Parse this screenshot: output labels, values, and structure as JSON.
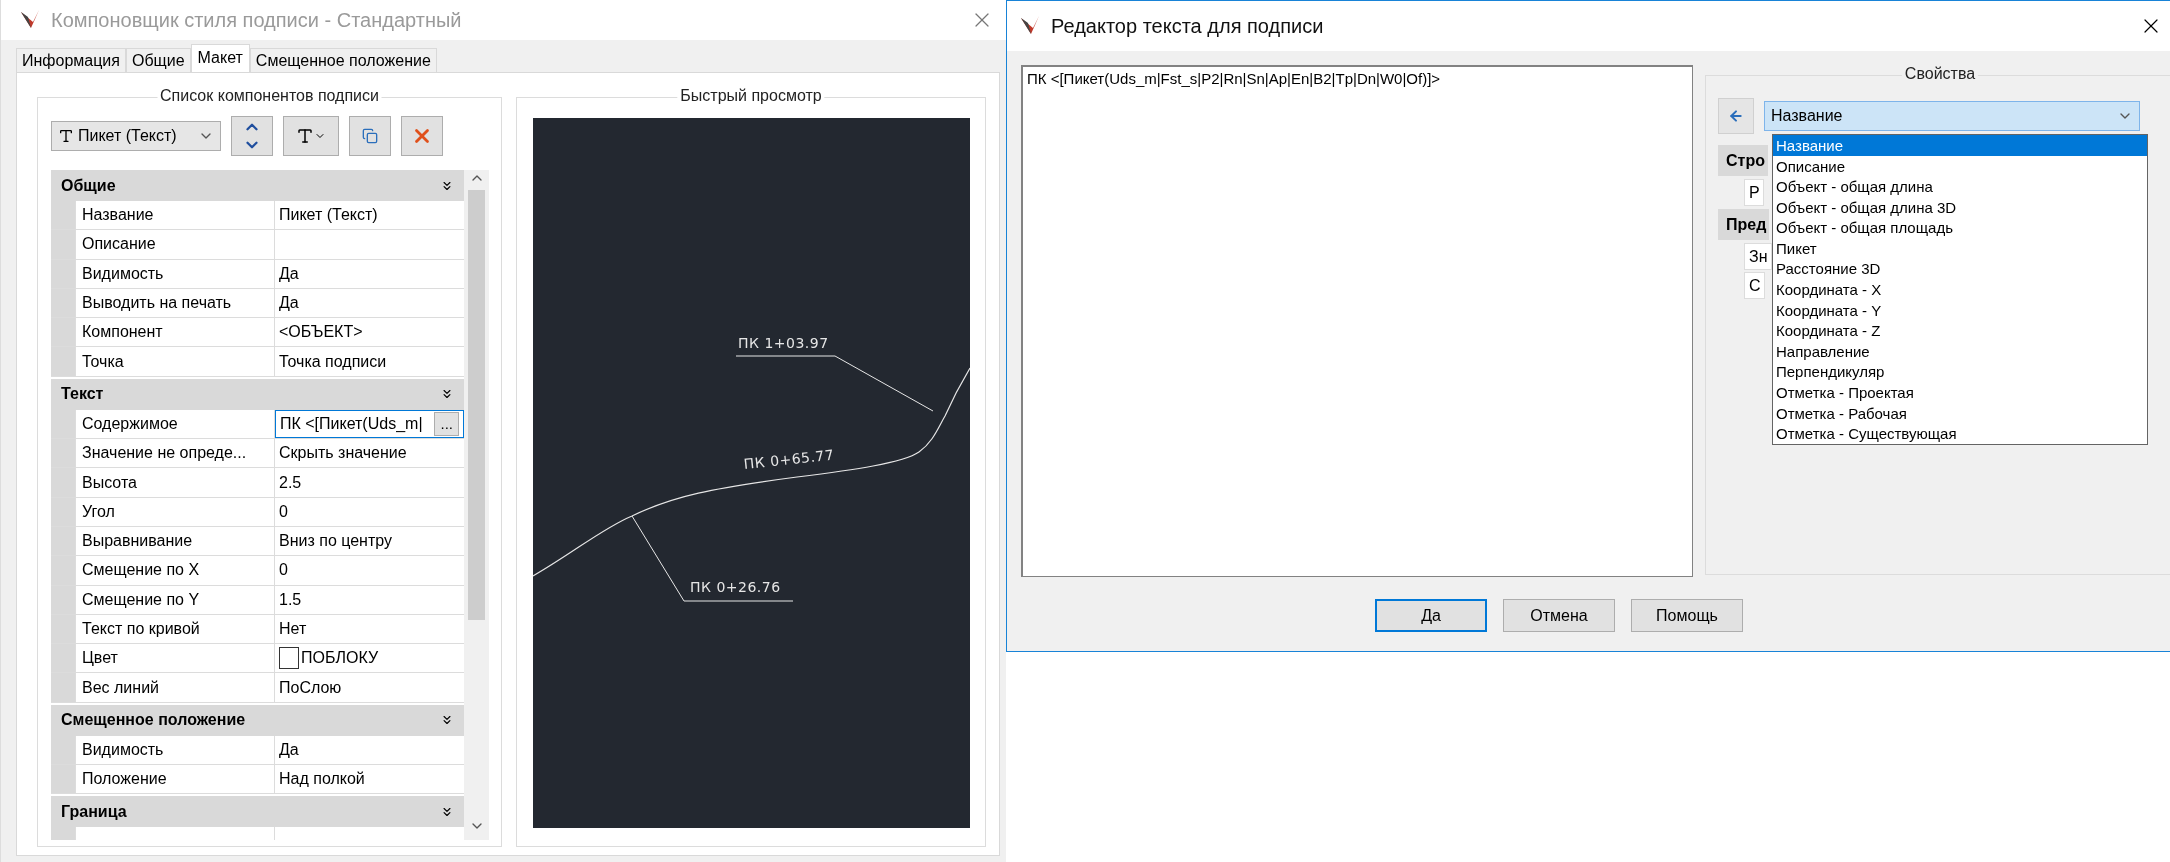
{
  "main_window": {
    "title": "Компоновщик стиля подписи - Стандартный",
    "tabs": [
      {
        "label": "Информация",
        "selected": false
      },
      {
        "label": "Общие",
        "selected": false
      },
      {
        "label": "Макет",
        "selected": true
      },
      {
        "label": "Смещенное положение",
        "selected": false
      }
    ],
    "components_group": {
      "title": "Список компонентов подписи",
      "component_select": "Пикет (Текст)",
      "categories": [
        {
          "name": "Общие",
          "properties": [
            {
              "kind": "text",
              "name": "Название",
              "value": "Пикет (Текст)"
            },
            {
              "kind": "text",
              "name": "Описание"
            },
            {
              "kind": "text",
              "name": "Видимость",
              "value": "Да"
            },
            {
              "kind": "text",
              "name": "Выводить на печать",
              "value": "Да"
            },
            {
              "kind": "text",
              "name": "Компонент",
              "value": "<ОБЪЕКТ>"
            },
            {
              "kind": "text",
              "name": "Точка",
              "value": "Точка подписи"
            }
          ]
        },
        {
          "name": "Текст",
          "properties": [
            {
              "kind": "editing",
              "name": "Содержимое",
              "value": "ПК <[Пикет(Uds_m|",
              "button": "..."
            },
            {
              "kind": "text",
              "name": "Значение не опреде...",
              "value": "Скрыть значение"
            },
            {
              "kind": "text",
              "name": "Высота",
              "value": "2.5"
            },
            {
              "kind": "text",
              "name": "Угол",
              "value": "0"
            },
            {
              "kind": "text",
              "name": "Выравнивание",
              "value": "Вниз по центру"
            },
            {
              "kind": "text",
              "name": "Смещение по X",
              "value": "0"
            },
            {
              "kind": "text",
              "name": "Смещение по Y",
              "value": "1.5"
            },
            {
              "kind": "text",
              "name": "Текст по кривой",
              "value": "Нет"
            },
            {
              "kind": "color",
              "name": "Цвет",
              "value": "ПОБЛОКУ"
            },
            {
              "kind": "text",
              "name": "Вес линий",
              "value": "ПоСлою"
            }
          ]
        },
        {
          "name": "Смещенное положение",
          "properties": [
            {
              "kind": "text",
              "name": "Видимость",
              "value": "Да"
            },
            {
              "kind": "text",
              "name": "Положение",
              "value": "Над полкой"
            }
          ]
        },
        {
          "name": "Граница",
          "properties": [
            {
              "kind": "text"
            }
          ]
        }
      ]
    },
    "preview_group": {
      "title": "Быстрый просмотр",
      "labels": [
        "ПК 1+03.97",
        "ПК 0+65.77",
        "ПК 0+26.76"
      ]
    }
  },
  "text_editor": {
    "title": "Редактор текста для подписи",
    "content": "ПК <[Пикет(Uds_m|Fst_s|P2|Rn|Sn|Ap|En|B2|Tp|Dn|W0|Of)]>",
    "properties_group": {
      "title": "Свойства",
      "field_select": "Название",
      "hidden_rows": [
        {
          "kind": "header",
          "text": "Стро"
        },
        {
          "kind": "row",
          "text": "Р"
        },
        {
          "kind": "header",
          "text": "Пред"
        },
        {
          "kind": "row",
          "text": "Зн"
        },
        {
          "kind": "row",
          "text": "С"
        }
      ],
      "options": [
        {
          "label": "Название",
          "selected": true
        },
        {
          "label": "Описание",
          "selected": false
        },
        {
          "label": "Объект - общая длина",
          "selected": false
        },
        {
          "label": "Объект - общая длина 3D",
          "selected": false
        },
        {
          "label": "Объект - общая площадь",
          "selected": false
        },
        {
          "label": "Пикет",
          "selected": false
        },
        {
          "label": "Расстояние 3D",
          "selected": false
        },
        {
          "label": "Координата - X",
          "selected": false
        },
        {
          "label": "Координата - Y",
          "selected": false
        },
        {
          "label": "Координата - Z",
          "selected": false
        },
        {
          "label": "Направление",
          "selected": false
        },
        {
          "label": "Перпендикуляр",
          "selected": false
        },
        {
          "label": "Отметка - Проектая",
          "selected": false
        },
        {
          "label": "Отметка - Рабочая",
          "selected": false
        },
        {
          "label": "Отметка - Существующая",
          "selected": false
        }
      ]
    },
    "buttons": [
      {
        "label": "Да",
        "default": true
      },
      {
        "label": "Отмена",
        "default": false
      },
      {
        "label": "Помощь",
        "default": false
      }
    ]
  }
}
